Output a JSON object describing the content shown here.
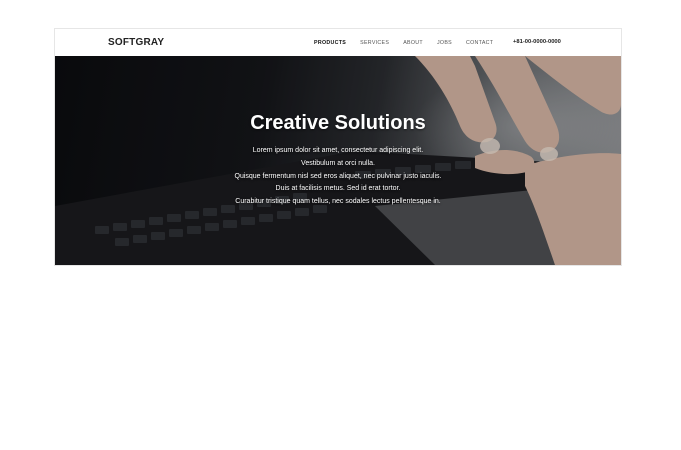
{
  "brand": "SOFTGRAY",
  "nav": [
    {
      "label": "PRODUCTS",
      "active": true
    },
    {
      "label": "SERVICES",
      "active": false
    },
    {
      "label": "ABOUT",
      "active": false
    },
    {
      "label": "JOBS",
      "active": false
    },
    {
      "label": "CONTACT",
      "active": false
    }
  ],
  "phone": "+81-00-0000-0000",
  "hero": {
    "title": "Creative Solutions",
    "lines": [
      "Lorem ipsum dolor sit amet, consectetur adipiscing elit.",
      "Vestibulum at orci nulla.",
      "Quisque fermentum nisl sed eros aliquet, nec pulvinar justo iaculis.",
      "Duis at facilisis metus. Sed id erat tortor.",
      "Curabitur tristique quam tellus, nec sodales lectus pellentesque in."
    ]
  },
  "colors": {
    "nav_bg": "#ffffff",
    "text_dark": "#222222",
    "hero_text": "#ffffff"
  }
}
